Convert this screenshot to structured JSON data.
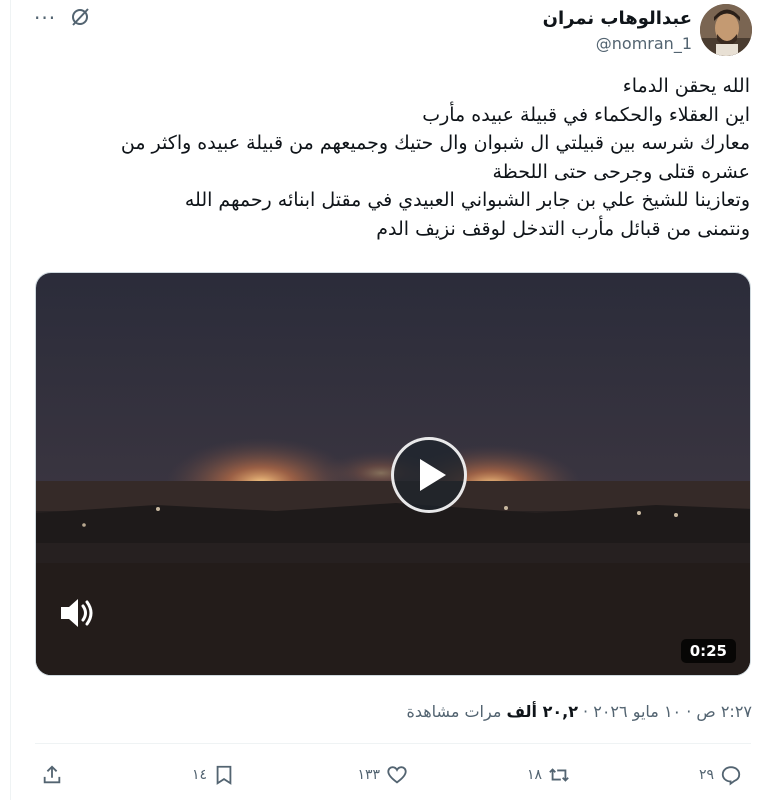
{
  "author": {
    "name": "عبدالوهاب نمران",
    "handle": "@nomran_1"
  },
  "header": {
    "more_icon": "more-icon",
    "grok_icon": "grok-icon"
  },
  "tweet": {
    "lines": [
      "الله يحقن الدماء",
      "اين العقلاء والحكماء في قبيلة عبيده مأرب",
      "معارك شرسه بين قبيلتي ال شبوان وال حتيك وجميعهم من قبيلة عبيده واكثر من",
      "عشره قتلى وجرحى حتى اللحظة",
      "وتعازينا للشيخ علي بن جابر الشبواني العبيدي في مقتل ابنائه رحمهم الله",
      "ونتمنى من قبائل مأرب التدخل لوقف نزيف الدم"
    ]
  },
  "video": {
    "duration": "0:25",
    "play_icon": "play-icon",
    "volume_icon": "volume-icon"
  },
  "meta": {
    "time_date": "٢:٢٧ ص · ١٠ مايو ٢٠٢٦ · ",
    "views_count": "٢٠,٢ ألف",
    "views_label": " مرات مشاهدة"
  },
  "actions": {
    "replies": "٢٩",
    "reposts": "١٨",
    "likes": "١٣٣",
    "bookmarks": "١٤"
  }
}
